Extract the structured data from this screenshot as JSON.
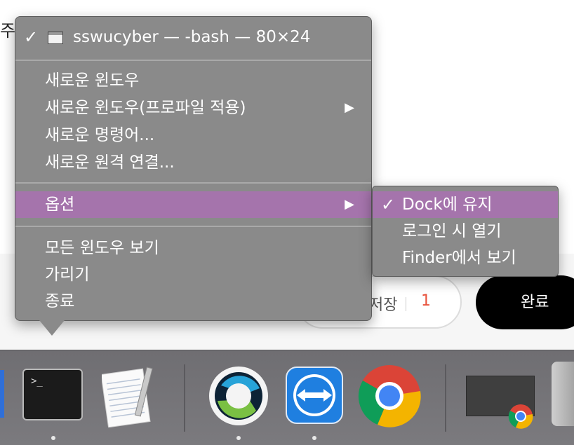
{
  "page": {
    "left_char": "주",
    "draft_label": "저장",
    "draft_count": "1",
    "done_label": "완료"
  },
  "menu": {
    "window_title": "sswucyber — -bash — 80×24",
    "items_group1": [
      "새로운 윈도우",
      "새로운 윈도우(프로파일 적용)",
      "새로운 명령어...",
      "새로운 원격 연결..."
    ],
    "options_label": "옵션",
    "items_group3": [
      "모든 윈도우 보기",
      "가리기",
      "종료"
    ]
  },
  "submenu": {
    "items": [
      "Dock에 유지",
      "로그인 시 열기",
      "Finder에서 보기"
    ],
    "checked": "Dock에 유지"
  },
  "dock": {
    "apps": [
      "terminal-icon",
      "textedit-icon",
      "webex-icon",
      "teamviewer-icon",
      "chrome-icon",
      "chrome-window-thumbnail",
      "trash-icon"
    ],
    "terminal_prompt": ">_"
  },
  "colors": {
    "highlight": "#a574ac",
    "menu_bg": "#8a8a8a",
    "done_bg": "#000000",
    "draft_count": "#e8523c"
  }
}
